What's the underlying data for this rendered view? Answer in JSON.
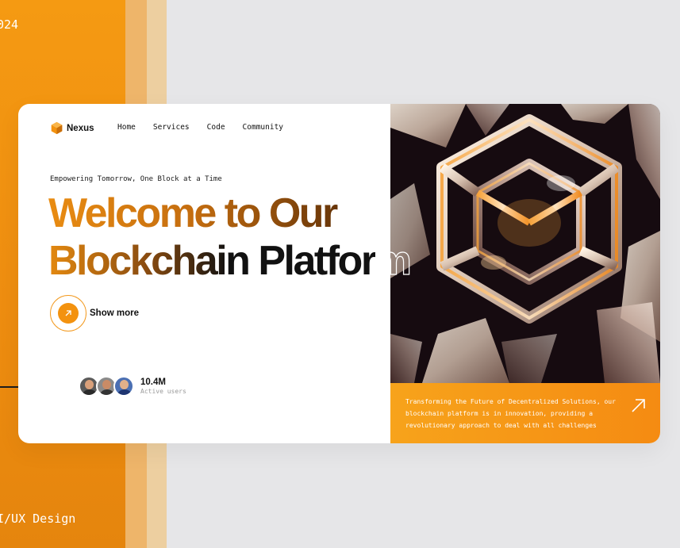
{
  "backdrop": {
    "corner_text_top": "024",
    "corner_text_bottom": "I/UX Design"
  },
  "brand": {
    "name": "Nexus",
    "logo_icon": "hexagon-logo-icon"
  },
  "nav": {
    "items": [
      {
        "label": "Home"
      },
      {
        "label": "Services"
      },
      {
        "label": "Code"
      },
      {
        "label": "Community"
      }
    ]
  },
  "hero": {
    "tagline": "Empowering Tomorrow, One Block at a Time",
    "headline_line1": "Welcome to Our",
    "headline_line2_solid": "Blockchain Platfor",
    "headline_line2_outline": "m",
    "cta_label": "Show more",
    "cta_icon": "arrow-up-right-icon"
  },
  "users": {
    "count": "10.4M",
    "label": "Active users"
  },
  "info_panel": {
    "text": "Transforming the Future of Decentralized Solutions, our blockchain platform is in innovation, providing a revolutionary approach to deal with all challenges",
    "arrow_icon": "arrow-up-right-icon"
  },
  "colors": {
    "accent": "#f3920f",
    "accent_light": "#f7a31b",
    "backdrop_orange": "#f59a12",
    "text_dark": "#111111",
    "hero_bg": "#160b10"
  }
}
